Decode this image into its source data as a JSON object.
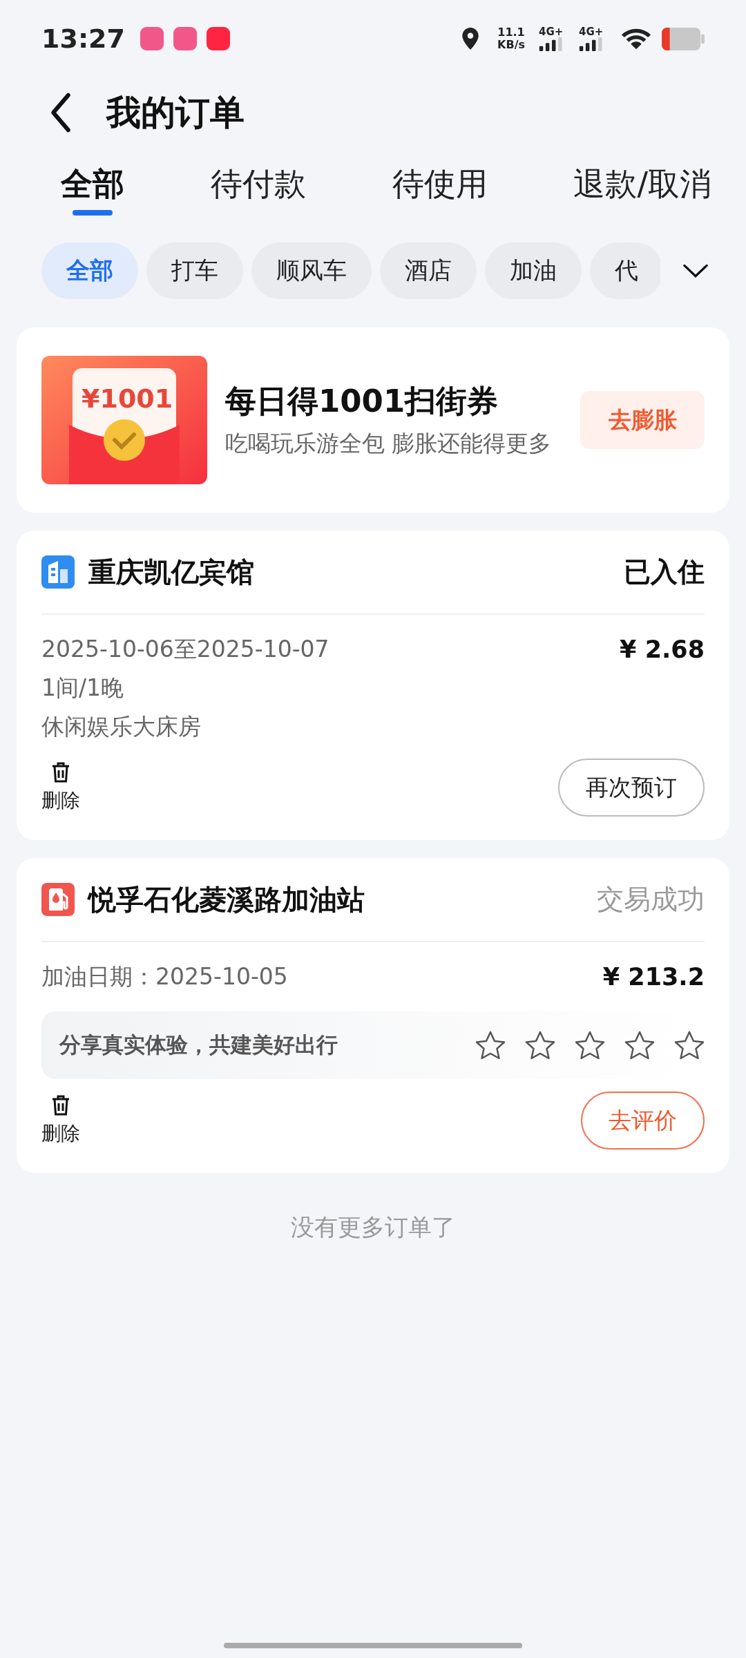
{
  "status_bar": {
    "time": "13:27",
    "speed_value": "11.1",
    "speed_unit": "KB/s",
    "networks": [
      {
        "label": "4G+"
      },
      {
        "label": "4G+"
      }
    ]
  },
  "header": {
    "title": "我的订单"
  },
  "tabs": [
    {
      "label": "全部",
      "selected": true
    },
    {
      "label": "待付款",
      "selected": false
    },
    {
      "label": "待使用",
      "selected": false
    },
    {
      "label": "退款/取消",
      "selected": false
    }
  ],
  "filters": [
    {
      "label": "全部",
      "selected": true
    },
    {
      "label": "打车",
      "selected": false
    },
    {
      "label": "顺风车",
      "selected": false
    },
    {
      "label": "酒店",
      "selected": false
    },
    {
      "label": "加油",
      "selected": false
    },
    {
      "label": "代",
      "selected": false
    }
  ],
  "promo": {
    "badge": "¥1001",
    "title": "每日得1001扫街券",
    "subtitle": "吃喝玩乐游全包 膨胀还能得更多",
    "button": "去膨胀"
  },
  "orders": [
    {
      "kind": "hotel",
      "name": "重庆凯亿宾馆",
      "status": "已入住",
      "status_muted": false,
      "lines": [
        "2025-10-06至2025-10-07",
        "1间/1晚",
        "休闲娱乐大床房"
      ],
      "price": "¥ 2.68",
      "delete_label": "删除",
      "action": {
        "label": "再次预订",
        "primary": false
      }
    },
    {
      "kind": "fuel",
      "name": "悦孚石化菱溪路加油站",
      "status": "交易成功",
      "status_muted": true,
      "lines": [
        "加油日期：2025-10-05"
      ],
      "price": "¥ 213.2",
      "rating": {
        "prompt": "分享真实体验，共建美好出行",
        "stars": 0
      },
      "delete_label": "删除",
      "action": {
        "label": "去评价",
        "primary": true
      }
    }
  ],
  "footer": "没有更多订单了"
}
